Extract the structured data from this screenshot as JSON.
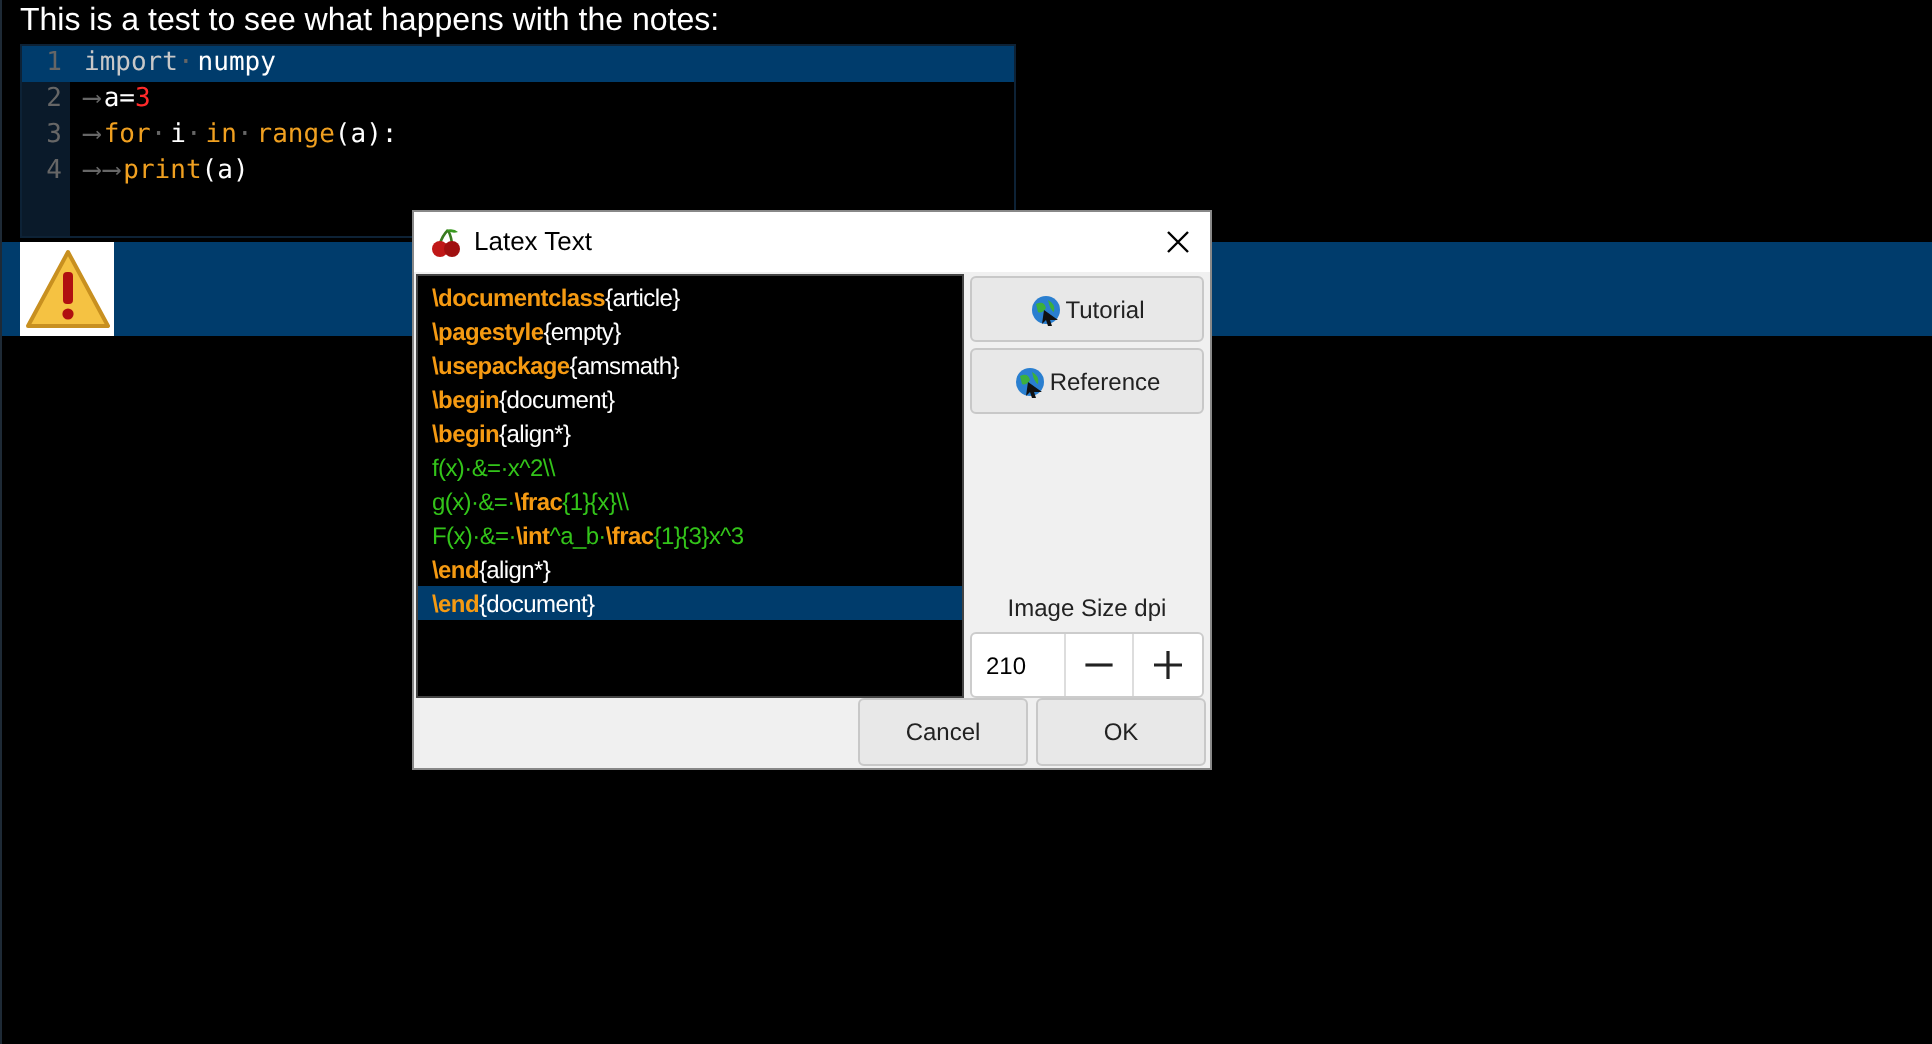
{
  "note": "This is a test to see what happens with the notes:",
  "code_editor": {
    "lines": [
      {
        "number": "1",
        "selected": true,
        "tokens": [
          {
            "text": "import",
            "kind": "plain"
          },
          {
            "text": "·",
            "kind": "ws"
          },
          {
            "text": "numpy",
            "kind": "name"
          }
        ]
      },
      {
        "number": "2",
        "selected": false,
        "tokens": [
          {
            "text": "⟶",
            "kind": "ws"
          },
          {
            "text": "a=",
            "kind": "name"
          },
          {
            "text": "3",
            "kind": "number"
          }
        ]
      },
      {
        "number": "3",
        "selected": false,
        "tokens": [
          {
            "text": "⟶",
            "kind": "ws"
          },
          {
            "text": "for",
            "kind": "keyword"
          },
          {
            "text": "·",
            "kind": "ws"
          },
          {
            "text": "i",
            "kind": "name"
          },
          {
            "text": "·",
            "kind": "ws"
          },
          {
            "text": "in",
            "kind": "keyword"
          },
          {
            "text": "·",
            "kind": "ws"
          },
          {
            "text": "range",
            "kind": "keyword"
          },
          {
            "text": "(a):",
            "kind": "name"
          }
        ]
      },
      {
        "number": "4",
        "selected": false,
        "tokens": [
          {
            "text": "⟶",
            "kind": "ws"
          },
          {
            "text": "⟶",
            "kind": "ws"
          },
          {
            "text": "print",
            "kind": "keyword"
          },
          {
            "text": "(a)",
            "kind": "name"
          }
        ]
      }
    ]
  },
  "dialog": {
    "title": "Latex Text",
    "lines": [
      {
        "selected": false,
        "tokens": [
          {
            "text": "\\documentclass",
            "kind": "command"
          },
          {
            "text": "{article}",
            "kind": "text"
          }
        ]
      },
      {
        "selected": false,
        "tokens": [
          {
            "text": "\\pagestyle",
            "kind": "command"
          },
          {
            "text": "{empty}",
            "kind": "text"
          }
        ]
      },
      {
        "selected": false,
        "tokens": [
          {
            "text": "\\usepackage",
            "kind": "command"
          },
          {
            "text": "{amsmath}",
            "kind": "text"
          }
        ]
      },
      {
        "selected": false,
        "tokens": [
          {
            "text": "\\begin",
            "kind": "command"
          },
          {
            "text": "{document}",
            "kind": "text"
          }
        ]
      },
      {
        "selected": false,
        "tokens": [
          {
            "text": "\\begin",
            "kind": "command"
          },
          {
            "text": "{align*}",
            "kind": "text"
          }
        ]
      },
      {
        "selected": false,
        "tokens": [
          {
            "text": "f(x)·&=·x^2\\\\",
            "kind": "math"
          }
        ]
      },
      {
        "selected": false,
        "tokens": [
          {
            "text": "g(x)·&=·",
            "kind": "math"
          },
          {
            "text": "\\frac",
            "kind": "command"
          },
          {
            "text": "{1}{x}\\\\",
            "kind": "math"
          }
        ]
      },
      {
        "selected": false,
        "tokens": [
          {
            "text": "F(x)·&=·",
            "kind": "math"
          },
          {
            "text": "\\int",
            "kind": "command"
          },
          {
            "text": "^a_b·",
            "kind": "math"
          },
          {
            "text": "\\frac",
            "kind": "command"
          },
          {
            "text": "{1}{3}x^3",
            "kind": "math"
          }
        ]
      },
      {
        "selected": false,
        "tokens": [
          {
            "text": "\\end",
            "kind": "command"
          },
          {
            "text": "{align*}",
            "kind": "text"
          }
        ]
      },
      {
        "selected": true,
        "tokens": [
          {
            "text": "\\end",
            "kind": "command"
          },
          {
            "text": "{document}",
            "kind": "text"
          }
        ]
      }
    ],
    "links": [
      "Tutorial",
      "Reference"
    ],
    "dpi_label": "Image Size dpi",
    "dpi_value": "210",
    "buttons": [
      "Cancel",
      "OK"
    ]
  }
}
